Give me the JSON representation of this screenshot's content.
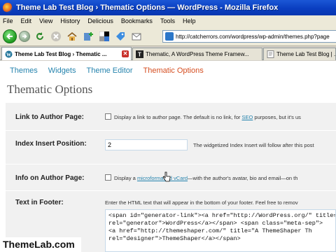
{
  "window": {
    "title": "Theme Lab Test Blog › Thematic Options — WordPress - Mozilla Firefox"
  },
  "menu": [
    "File",
    "Edit",
    "View",
    "History",
    "Delicious",
    "Bookmarks",
    "Tools",
    "Help"
  ],
  "address": {
    "url": "http://catcherrors.com/wordpress/wp-admin/themes.php?page"
  },
  "tabs": [
    {
      "label": "Theme Lab Test Blog › Thematic ..."
    },
    {
      "label": "Thematic, A WordPress Theme Framew..."
    },
    {
      "label": "Theme Lab Test Blog | ..."
    }
  ],
  "subnav": [
    "Themes",
    "Widgets",
    "Theme Editor",
    "Thematic Options"
  ],
  "page": {
    "title": "Thematic Options"
  },
  "options": {
    "author_link": {
      "label": "Link to Author Page:",
      "desc_pre": "Display a link to author page. The default is no link, for ",
      "desc_link": "SEO",
      "desc_post": " purposes, but it's us"
    },
    "index_insert": {
      "label": "Index Insert Position:",
      "value": "2",
      "desc": "The widgetized Index Insert will follow after this post"
    },
    "author_info": {
      "label": "Info on Author Page:",
      "desc_pre": "Display a ",
      "desc_link": "microformatted vCard",
      "desc_post": "—with the author's avatar, bio and email—on th"
    },
    "footer_text": {
      "label": "Text in Footer:",
      "desc": "Enter the HTML text that will appear in the bottom of your footer. Feel free to remov",
      "code": "<span id=\"generator-link\"><a href=\"http://WordPress.org/\" title=\"W\nrel=\"generator\">WordPress</a></span> <span class=\"meta-sep\">\n<a href=\"http://themeshaper.com/\" title=\"A ThemeShaper Th\nrel=\"designer\">ThemeShaper</a></span>"
    }
  },
  "watermark": "ThemeLab.com"
}
